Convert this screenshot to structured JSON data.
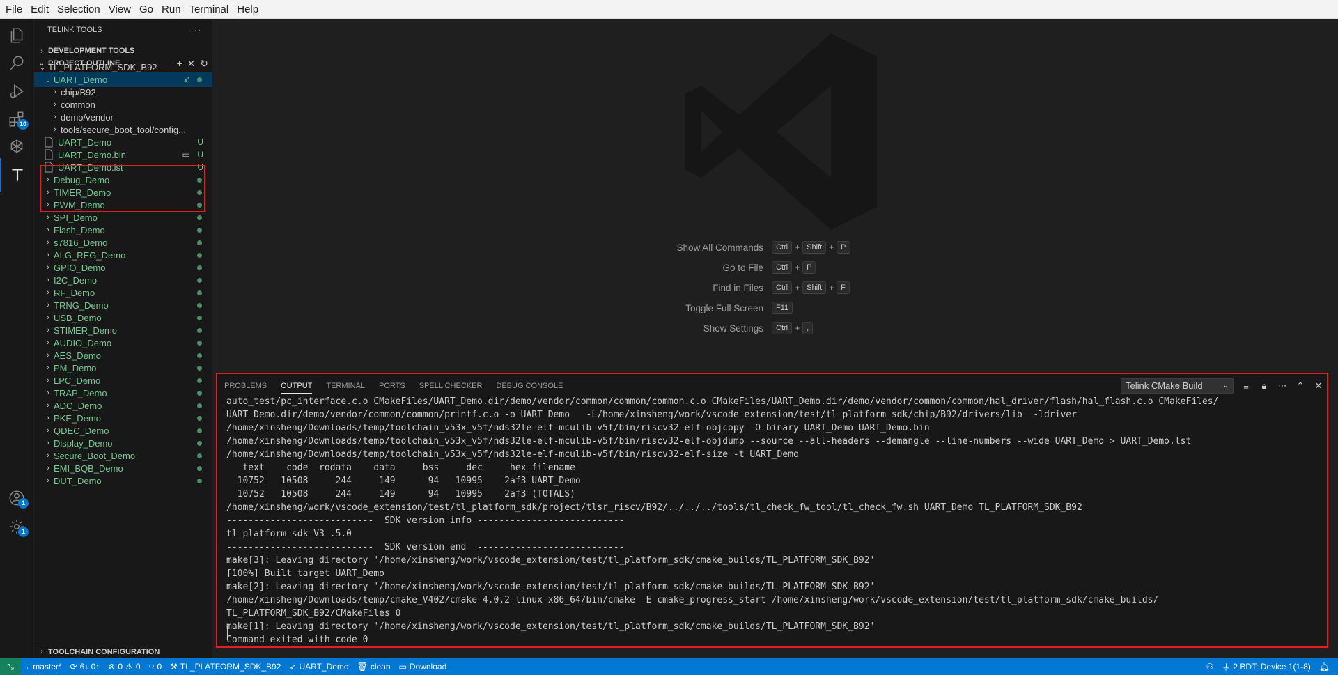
{
  "menu": [
    "File",
    "Edit",
    "Selection",
    "View",
    "Go",
    "Run",
    "Terminal",
    "Help"
  ],
  "activity_badges": {
    "extensions": "10",
    "accounts": "1",
    "manage": "1"
  },
  "sidebar": {
    "title": "TELINK TOOLS",
    "more": "···",
    "dev_tools": "DEVELOPMENT TOOLS",
    "project_outline": "PROJECT OUTLINE",
    "root": "TL_PLATFORM_SDK_B92",
    "active_project": "UART_Demo",
    "folders": [
      "chip/B92",
      "common",
      "demo/vendor",
      "tools/secure_boot_tool/config..."
    ],
    "files": [
      {
        "name": "UART_Demo",
        "status": "U"
      },
      {
        "name": "UART_Demo.bin",
        "status": "U"
      },
      {
        "name": "UART_Demo.lst",
        "status": "U"
      }
    ],
    "projects": [
      "Debug_Demo",
      "TIMER_Demo",
      "PWM_Demo",
      "SPI_Demo",
      "Flash_Demo",
      "s7816_Demo",
      "ALG_REG_Demo",
      "GPIO_Demo",
      "I2C_Demo",
      "RF_Demo",
      "TRNG_Demo",
      "USB_Demo",
      "STIMER_Demo",
      "AUDIO_Demo",
      "AES_Demo",
      "PM_Demo",
      "LPC_Demo",
      "TRAP_Demo",
      "ADC_Demo",
      "PKE_Demo",
      "QDEC_Demo",
      "Display_Demo",
      "Secure_Boot_Demo",
      "EMI_BQB_Demo",
      "DUT_Demo"
    ],
    "toolchain": "TOOLCHAIN CONFIGURATION"
  },
  "shortcuts": [
    {
      "label": "Show All Commands",
      "keys": [
        "Ctrl",
        "Shift",
        "P"
      ]
    },
    {
      "label": "Go to File",
      "keys": [
        "Ctrl",
        "P"
      ]
    },
    {
      "label": "Find in Files",
      "keys": [
        "Ctrl",
        "Shift",
        "F"
      ]
    },
    {
      "label": "Toggle Full Screen",
      "keys": [
        "F11"
      ]
    },
    {
      "label": "Show Settings",
      "keys": [
        "Ctrl",
        ","
      ]
    }
  ],
  "panel": {
    "tabs": [
      "PROBLEMS",
      "OUTPUT",
      "TERMINAL",
      "PORTS",
      "SPELL CHECKER",
      "DEBUG CONSOLE"
    ],
    "active_tab": "OUTPUT",
    "channel": "Telink CMake Build",
    "output_lines": [
      "auto_test/pc_interface.c.o CMakeFiles/UART_Demo.dir/demo/vendor/common/common/common.c.o CMakeFiles/UART_Demo.dir/demo/vendor/common/common/hal_driver/flash/hal_flash.c.o CMakeFiles/",
      "UART_Demo.dir/demo/vendor/common/common/printf.c.o -o UART_Demo   -L/home/xinsheng/work/vscode_extension/test/tl_platform_sdk/chip/B92/drivers/lib  -ldriver",
      "/home/xinsheng/Downloads/temp/toolchain_v53x_v5f/nds32le-elf-mculib-v5f/bin/riscv32-elf-objcopy -O binary UART_Demo UART_Demo.bin",
      "/home/xinsheng/Downloads/temp/toolchain_v53x_v5f/nds32le-elf-mculib-v5f/bin/riscv32-elf-objdump --source --all-headers --demangle --line-numbers --wide UART_Demo > UART_Demo.lst",
      "/home/xinsheng/Downloads/temp/toolchain_v53x_v5f/nds32le-elf-mculib-v5f/bin/riscv32-elf-size -t UART_Demo",
      "   text    code  rodata    data     bss     dec     hex filename",
      "  10752   10508     244     149      94   10995    2af3 UART_Demo",
      "  10752   10508     244     149      94   10995    2af3 (TOTALS)",
      "/home/xinsheng/work/vscode_extension/test/tl_platform_sdk/project/tlsr_riscv/B92/../../../tools/tl_check_fw_tool/tl_check_fw.sh UART_Demo TL_PLATFORM_SDK_B92",
      "---------------------------  SDK version info ---------------------------",
      "tl_platform_sdk_V3 .5.0",
      "---------------------------  SDK version end  ---------------------------",
      "make[3]: Leaving directory '/home/xinsheng/work/vscode_extension/test/tl_platform_sdk/cmake_builds/TL_PLATFORM_SDK_B92'",
      "[100%] Built target UART_Demo",
      "make[2]: Leaving directory '/home/xinsheng/work/vscode_extension/test/tl_platform_sdk/cmake_builds/TL_PLATFORM_SDK_B92'",
      "/home/xinsheng/Downloads/temp/cmake_V402/cmake-4.0.2-linux-x86_64/bin/cmake -E cmake_progress_start /home/xinsheng/work/vscode_extension/test/tl_platform_sdk/cmake_builds/",
      "TL_PLATFORM_SDK_B92/CMakeFiles 0",
      "make[1]: Leaving directory '/home/xinsheng/work/vscode_extension/test/tl_platform_sdk/cmake_builds/TL_PLATFORM_SDK_B92'",
      "Command exited with code 0"
    ]
  },
  "status": {
    "branch": "master*",
    "sync": "6↓ 0↑",
    "errors": "0",
    "warnings": "0",
    "ports": "0",
    "sdk": "TL_PLATFORM_SDK_B92",
    "project": "UART_Demo",
    "clean": "clean",
    "download": "Download",
    "bdt": "2 BDT: Device 1(1-8)"
  }
}
